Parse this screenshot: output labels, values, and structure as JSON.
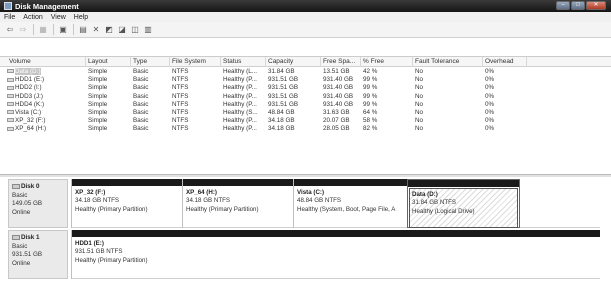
{
  "window": {
    "title": "Disk Management"
  },
  "menu": {
    "items": [
      "File",
      "Action",
      "View",
      "Help"
    ]
  },
  "toolbar": {
    "icons": [
      "back-icon",
      "forward-icon",
      "console-tree-icon",
      "help-icon",
      "properties-icon",
      "delete-icon",
      "refresh-icon",
      "rescan-icon",
      "settings-icon",
      "export-icon"
    ]
  },
  "volumes": {
    "columns": [
      "Volume",
      "Layout",
      "Type",
      "File System",
      "Status",
      "Capacity",
      "Free Spa...",
      "% Free",
      "Fault Tolerance",
      "Overhead"
    ],
    "rows": [
      [
        "Data (D:)",
        "Simple",
        "Basic",
        "NTFS",
        "Healthy (L...",
        "31.84 GB",
        "13.51 GB",
        "42 %",
        "No",
        "0%"
      ],
      [
        "HDD1 (E:)",
        "Simple",
        "Basic",
        "NTFS",
        "Healthy (P...",
        "931.51 GB",
        "931.40 GB",
        "99 %",
        "No",
        "0%"
      ],
      [
        "HDD2 (I:)",
        "Simple",
        "Basic",
        "NTFS",
        "Healthy (P...",
        "931.51 GB",
        "931.40 GB",
        "99 %",
        "No",
        "0%"
      ],
      [
        "HDD3 (J:)",
        "Simple",
        "Basic",
        "NTFS",
        "Healthy (P...",
        "931.51 GB",
        "931.40 GB",
        "99 %",
        "No",
        "0%"
      ],
      [
        "HDD4 (K:)",
        "Simple",
        "Basic",
        "NTFS",
        "Healthy (P...",
        "931.51 GB",
        "931.40 GB",
        "99 %",
        "No",
        "0%"
      ],
      [
        "Vista (C:)",
        "Simple",
        "Basic",
        "NTFS",
        "Healthy (S...",
        "48.84 GB",
        "31.63 GB",
        "64 %",
        "No",
        "0%"
      ],
      [
        "XP_32 (F:)",
        "Simple",
        "Basic",
        "NTFS",
        "Healthy (P...",
        "34.18 GB",
        "20.07 GB",
        "58 %",
        "No",
        "0%"
      ],
      [
        "XP_64 (H:)",
        "Simple",
        "Basic",
        "NTFS",
        "Healthy (P...",
        "34.18 GB",
        "28.05 GB",
        "82 %",
        "No",
        "0%"
      ]
    ]
  },
  "disks": [
    {
      "name": "Disk 0",
      "type": "Basic",
      "size": "149.05 GB",
      "state": "Online",
      "partitions": [
        {
          "name": "XP_32 (F:)",
          "size": "34.18 GB NTFS",
          "status": "Healthy (Primary Partition)"
        },
        {
          "name": "XP_64 (H:)",
          "size": "34.18 GB NTFS",
          "status": "Healthy (Primary Partition)"
        },
        {
          "name": "Vista (C:)",
          "size": "48.84 GB NTFS",
          "status": "Healthy (System, Boot, Page File, A"
        },
        {
          "name": "Data (D:)",
          "size": "31.84 GB NTFS",
          "status": "Healthy (Logical Drive)"
        }
      ]
    },
    {
      "name": "Disk 1",
      "type": "Basic",
      "size": "931.51 GB",
      "state": "Online",
      "partitions": [
        {
          "name": "HDD1 (E:)",
          "size": "931.51 GB NTFS",
          "status": "Healthy (Primary Partition)"
        }
      ]
    }
  ]
}
